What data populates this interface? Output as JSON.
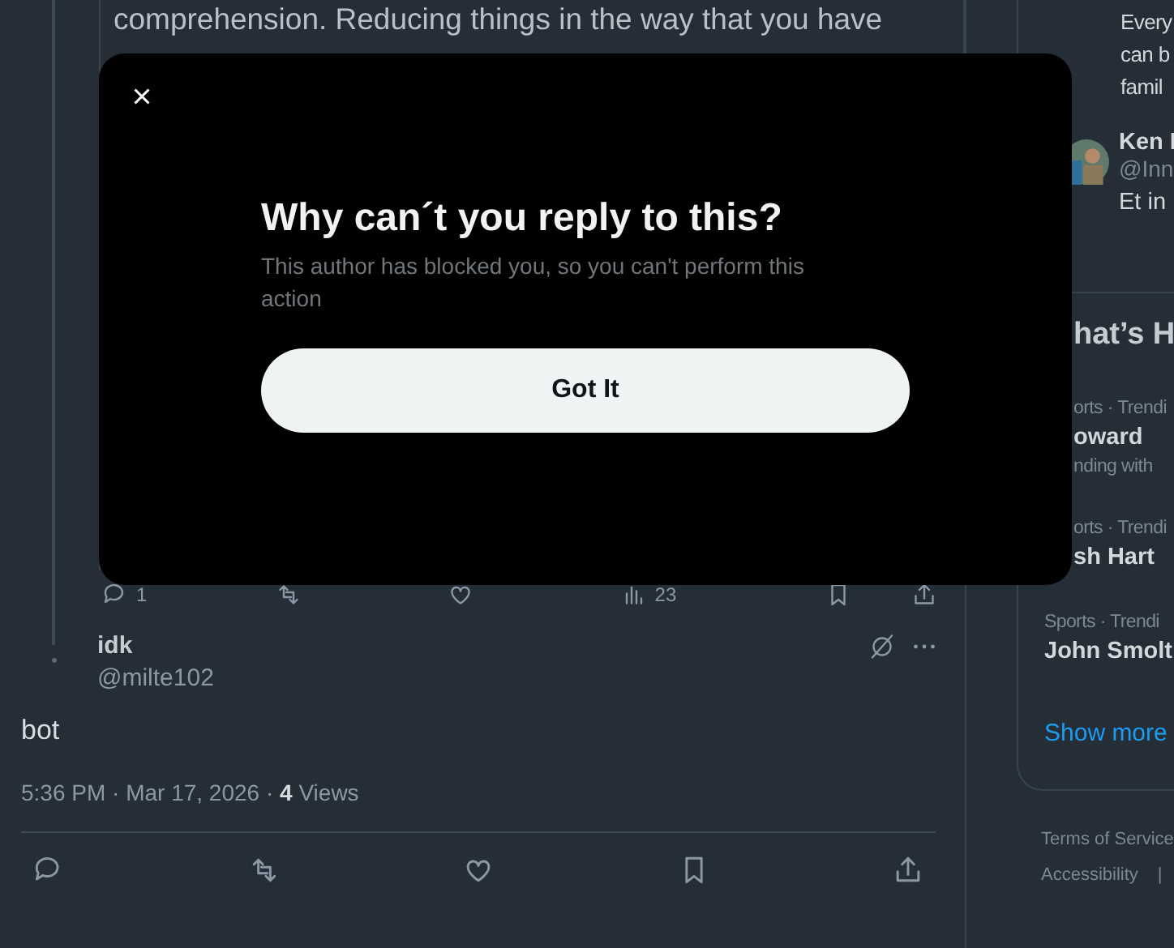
{
  "thread_tweet": {
    "text_lines": [
      "comprehension. Reducing things in the way that you have"
    ],
    "actions": [
      {
        "kind": "reply",
        "count": "1"
      },
      {
        "kind": "repost"
      },
      {
        "kind": "like"
      },
      {
        "kind": "views",
        "count": "23"
      },
      {
        "kind": "bookmark"
      },
      {
        "kind": "share"
      }
    ]
  },
  "reply": {
    "name": "idk",
    "handle": "@milte102",
    "text": "bot",
    "timestamp": "5:36 PM · Mar 17, 2026 · **4** Views",
    "actions": [
      {
        "kind": "reply"
      },
      {
        "kind": "repost"
      },
      {
        "kind": "like"
      },
      {
        "kind": "bookmark"
      },
      {
        "kind": "share"
      }
    ]
  },
  "sidebar": {
    "post_lines": [
      "Every",
      "can b",
      "famil"
    ],
    "user": {
      "name": "Ken I",
      "handle": "@Inn",
      "text": "Et in"
    },
    "trends_title": "hat’s H",
    "trends": [
      {
        "category": "orts · Trendi",
        "name": "oward",
        "context": "nding with"
      },
      {
        "category": "orts · Trendi",
        "name": "sh Hart"
      },
      {
        "category": "Sports · Trendi",
        "name": "John Smolt"
      }
    ],
    "show_more": "Show more",
    "footer": [
      "Terms of Service",
      "Accessibility",
      "|"
    ]
  },
  "dialog": {
    "title": "Why can´t you reply to this?",
    "message": "This author has blocked you, so you can't perform this action",
    "button": "Got It"
  }
}
